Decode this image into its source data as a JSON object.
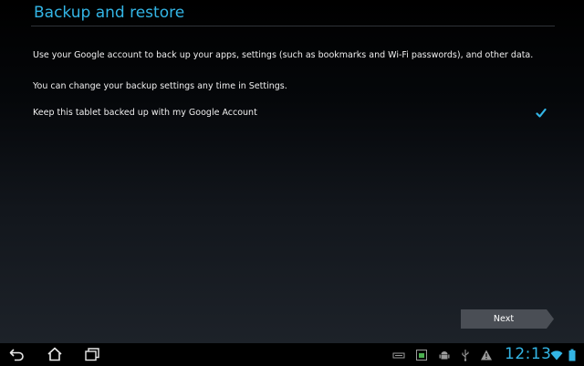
{
  "page": {
    "title": "Backup and restore",
    "paragraphs": [
      "Use your Google account to back up your apps, settings (such as bookmarks and Wi-Fi passwords), and other data.",
      "You can change your backup settings any time in Settings."
    ],
    "backup_option": {
      "label": "Keep this tablet backed up with my Google Account",
      "checked": true
    },
    "next_label": "Next"
  },
  "system_bar": {
    "nav_icons": [
      "back-icon",
      "home-icon",
      "recent-apps-icon"
    ],
    "status_icons": [
      "keyboard-icon",
      "screenshot-icon",
      "android-debug-icon",
      "usb-icon",
      "warning-icon",
      "wifi-icon",
      "battery-icon"
    ],
    "clock": "12:13"
  },
  "colors": {
    "accent": "#33b5e5",
    "text": "#f0f0f0",
    "background_top": "#000000",
    "background_bottom": "#1d2229",
    "button": "#4a4e55"
  }
}
